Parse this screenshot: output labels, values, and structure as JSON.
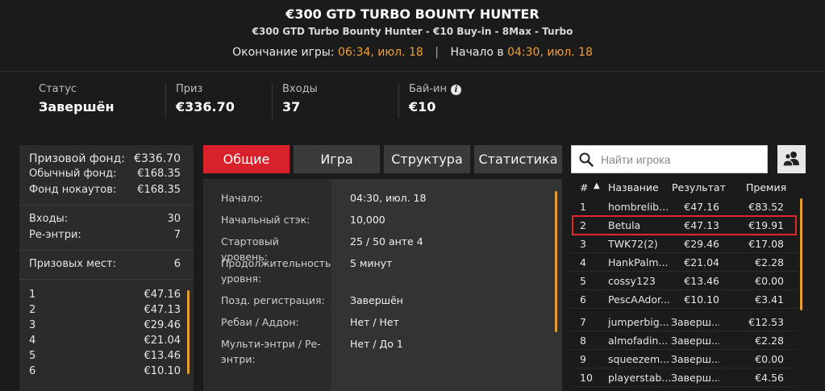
{
  "header": {
    "title": "€300 GTD TURBO BOUNTY HUNTER",
    "subtitle": "€300 GTD Turbo Bounty Hunter - €10 Buy-in - 8Max - Turbo",
    "end_label": "Окончание игры:",
    "end_time": "06:34, июл. 18",
    "separator": "|",
    "start_label": "Начало в",
    "start_time": "04:30, июл. 18"
  },
  "stats": {
    "status_label": "Статус",
    "status_value": "Завершён",
    "prize_label": "Приз",
    "prize_value": "€336.70",
    "entries_label": "Входы",
    "entries_value": "37",
    "buyin_label": "Бай-ин",
    "buyin_value": "€10",
    "info_icon": "i"
  },
  "left_panel": {
    "prize_pool_label": "Призовой фонд:",
    "prize_pool_value": "€336.70",
    "regular_fund_label": "Обычный фонд:",
    "regular_fund_value": "€168.35",
    "knockout_fund_label": "Фонд нокаутов:",
    "knockout_fund_value": "€168.35",
    "entries_label": "Входы:",
    "entries_value": "30",
    "reentries_label": "Ре-энтри:",
    "reentries_value": "7",
    "paid_places_label": "Призовых мест:",
    "paid_places_value": "6",
    "payouts": [
      {
        "place": "1",
        "amount": "€47.16"
      },
      {
        "place": "2",
        "amount": "€47.13"
      },
      {
        "place": "3",
        "amount": "€29.46"
      },
      {
        "place": "4",
        "amount": "€21.04"
      },
      {
        "place": "5",
        "amount": "€13.46"
      },
      {
        "place": "6",
        "amount": "€10.10"
      }
    ]
  },
  "tabs": {
    "general": "Общие",
    "game": "Игра",
    "structure": "Структура",
    "statistics": "Статистика"
  },
  "details": [
    {
      "key": "Начало:",
      "value": "04:30, июл. 18"
    },
    {
      "key": "Начальный стэк:",
      "value": "10,000"
    },
    {
      "key": "Стартовый уровень:",
      "value": "25 / 50 анте 4"
    },
    {
      "key": "Продолжительность уровня:",
      "value": "5 минут"
    },
    {
      "key": "Позд. регистрация:",
      "value": "Завершён"
    },
    {
      "key": "Ребаи / Аддон:",
      "value": "Нет / Нет"
    },
    {
      "key": "Мульти-энтри / Ре-энтри:",
      "value": "Нет / До 1"
    }
  ],
  "search": {
    "placeholder": "Найти игрока",
    "icon": "search-icon"
  },
  "friends_button": {
    "icon": "users-icon"
  },
  "players_table": {
    "headers": {
      "num": "#",
      "sort": "▲",
      "name": "Название",
      "result": "Результат",
      "prize": "Премия"
    },
    "rows": [
      {
        "num": "1",
        "name": "hombrelib...",
        "result": "€47.16",
        "prize": "€83.52"
      },
      {
        "num": "2",
        "name": "Betula",
        "result": "€47.13",
        "prize": "€19.91"
      },
      {
        "num": "3",
        "name": "TWK72(2)",
        "result": "€29.46",
        "prize": "€17.08"
      },
      {
        "num": "4",
        "name": "HankPalm...",
        "result": "€21.04",
        "prize": "€2.28"
      },
      {
        "num": "5",
        "name": "cossy123",
        "result": "€13.46",
        "prize": "€0.00"
      },
      {
        "num": "6",
        "name": "PescAAdor...",
        "result": "€10.10",
        "prize": "€3.41"
      },
      {
        "num": "7",
        "name": "jumperbig...",
        "result": "Заверш...",
        "prize": "€12.53"
      },
      {
        "num": "8",
        "name": "almofadin...",
        "result": "Заверш...",
        "prize": "€2.28"
      },
      {
        "num": "9",
        "name": "squeezem...",
        "result": "Заверш...",
        "prize": "€0.00"
      },
      {
        "num": "10",
        "name": "playerstab...",
        "result": "Заверш...",
        "prize": "€4.56"
      }
    ]
  },
  "colors": {
    "accent": "#d9212c",
    "orange": "#f0a030",
    "background": "#1b1b1b",
    "panel": "#2b2b2b"
  }
}
